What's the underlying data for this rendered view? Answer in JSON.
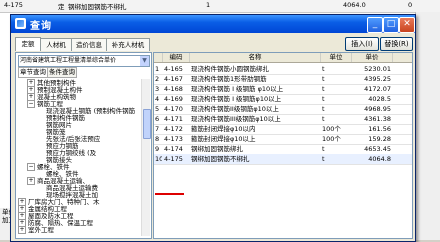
{
  "background": {
    "top_row": {
      "code": "4-175",
      "unit": "定",
      "name": "钢绑加固钢筋不绑扎",
      "qty": "1",
      "price": "4064.0",
      "amount": "0"
    },
    "left_panel": [
      "单位工程",
      "加工制作、安装"
    ]
  },
  "dialog": {
    "title": "查询",
    "tabs": [
      "定额",
      "人材机",
      "造价信息",
      "补充人材机"
    ],
    "insert_button": "插入(I)",
    "replace_button": "替换(R)",
    "combo_value": "河南省建筑工程工程量清单综合单价",
    "subtabs": [
      "章节查询",
      "条件查询"
    ],
    "tree": [
      {
        "indent": 1,
        "exp": "+",
        "label": "其他预制构件"
      },
      {
        "indent": 1,
        "exp": "+",
        "label": "预制混凝土构件"
      },
      {
        "indent": 1,
        "exp": "+",
        "label": "混凝土构筑物"
      },
      {
        "indent": 1,
        "exp": "−",
        "label": "钢筋工程"
      },
      {
        "indent": 2,
        "exp": "",
        "label": "现浇混凝土钢筋 (预制构件钢筋"
      },
      {
        "indent": 2,
        "exp": "",
        "label": "预制构件钢筋"
      },
      {
        "indent": 2,
        "exp": "",
        "label": "钢筋网片"
      },
      {
        "indent": 2,
        "exp": "",
        "label": "钢筋笼"
      },
      {
        "indent": 2,
        "exp": "",
        "label": "先张法/后张法预应"
      },
      {
        "indent": 2,
        "exp": "",
        "label": "预应力钢筋"
      },
      {
        "indent": 2,
        "exp": "",
        "label": "预应力钢绞线 (及"
      },
      {
        "indent": 2,
        "exp": "",
        "label": "钢筋接头"
      },
      {
        "indent": 1,
        "exp": "−",
        "label": "螺栓、铁件"
      },
      {
        "indent": 2,
        "exp": "",
        "label": "螺栓、铁件"
      },
      {
        "indent": 1,
        "exp": "+",
        "label": "商品混凝土运输、"
      },
      {
        "indent": 2,
        "exp": "",
        "label": "商品混凝土运输费"
      },
      {
        "indent": 2,
        "exp": "",
        "label": "现场搅拌混凝土加"
      },
      {
        "indent": 0,
        "exp": "+",
        "label": "厂库房大门、特种门、木"
      },
      {
        "indent": 0,
        "exp": "+",
        "label": "金属结构工程"
      },
      {
        "indent": 0,
        "exp": "+",
        "label": "屋面及防水工程"
      },
      {
        "indent": 0,
        "exp": "+",
        "label": "防腐、隔热、保温工程"
      },
      {
        "indent": 0,
        "exp": "+",
        "label": "室外工程"
      }
    ],
    "table": {
      "headers": [
        "",
        "编码",
        "名称",
        "单位",
        "单价"
      ],
      "rows": [
        {
          "n": "1",
          "code": "4-165",
          "name": "现浇构件钢筋小圆钢筋绑扎",
          "unit": "t",
          "price": "5230.01"
        },
        {
          "n": "2",
          "code": "4-167",
          "name": "现浇构件钢筋1形带肋钢筋",
          "unit": "t",
          "price": "4395.25"
        },
        {
          "n": "3",
          "code": "4-168",
          "name": "现浇构件钢筋 I 级钢筋 φ10以上",
          "unit": "t",
          "price": "4172.07"
        },
        {
          "n": "4",
          "code": "4-169",
          "name": "现浇构件钢筋 I 级钢筋φ10以上",
          "unit": "t",
          "price": "4028.5"
        },
        {
          "n": "5",
          "code": "4-170",
          "name": "现浇构件钢筋II级钢筋φ10以上",
          "unit": "t",
          "price": "4968.95"
        },
        {
          "n": "6",
          "code": "4-171",
          "name": "现浇构件钢筋III级钢筋φ10以上",
          "unit": "t",
          "price": "4361.38"
        },
        {
          "n": "7",
          "code": "4-172",
          "name": "箍筋封闭焊接φ10以内",
          "unit": "100个",
          "price": "161.56"
        },
        {
          "n": "8",
          "code": "4-173",
          "name": "箍筋封闭焊接φ10以上",
          "unit": "100个",
          "price": "159.28"
        },
        {
          "n": "9",
          "code": "4-174",
          "name": "钢绑加固钢筋绑扎",
          "unit": "t",
          "price": "4653.45"
        },
        {
          "n": "10",
          "code": "4-175",
          "name": "钢绑加固钢筋不绑扎",
          "unit": "t",
          "price": "4064.8"
        }
      ]
    }
  }
}
